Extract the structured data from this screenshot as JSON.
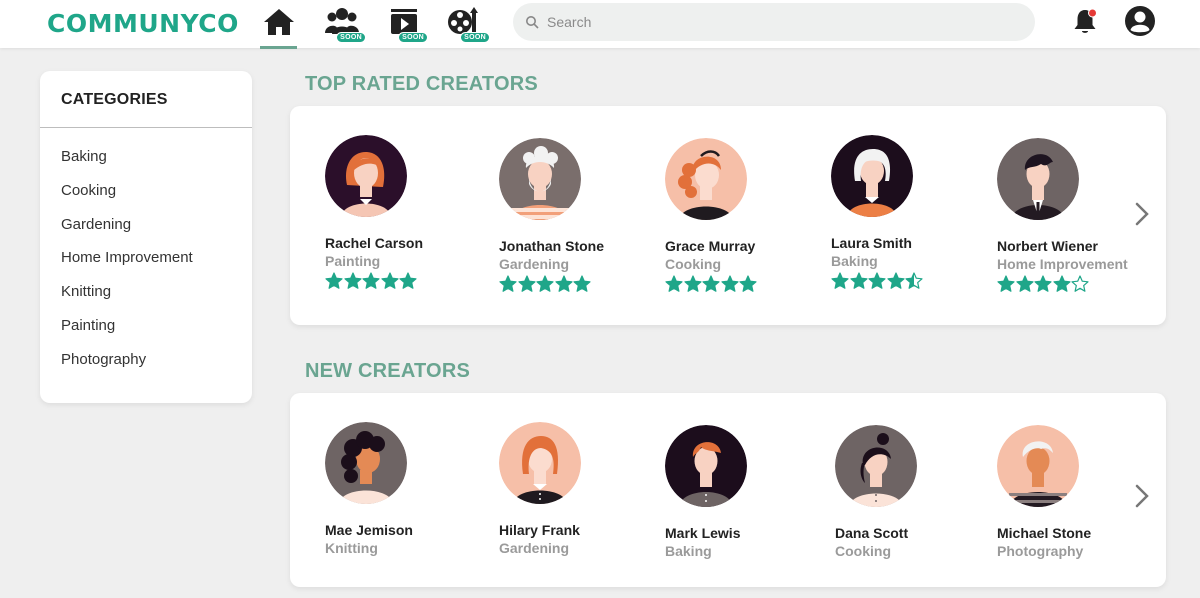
{
  "header": {
    "logo": "COMMUNYCO",
    "nav": [
      {
        "name": "home-icon",
        "active": true
      },
      {
        "name": "community-icon",
        "badge": "SOON"
      },
      {
        "name": "video-icon",
        "badge": "SOON"
      },
      {
        "name": "film-icon",
        "badge": "SOON"
      }
    ],
    "search_placeholder": "Search",
    "icons": [
      "search-icon",
      "bell-icon",
      "account-icon"
    ],
    "notification_dot_color": "#e53935"
  },
  "sidebar": {
    "title": "CATEGORIES",
    "items": [
      "Baking",
      "Cooking",
      "Gardening",
      "Home Improvement",
      "Knitting",
      "Painting",
      "Photography"
    ]
  },
  "top_rated": {
    "title": "TOP RATED CREATORS",
    "creators": [
      {
        "name": "Rachel Carson",
        "category": "Painting",
        "rating": 5
      },
      {
        "name": "Jonathan Stone",
        "category": "Gardening",
        "rating": 5
      },
      {
        "name": "Grace Murray",
        "category": "Cooking",
        "rating": 5
      },
      {
        "name": "Laura Smith",
        "category": "Baking",
        "rating": 4.5
      },
      {
        "name": "Norbert Wiener",
        "category": "Home Improvement",
        "rating": 4
      }
    ]
  },
  "new_creators": {
    "title": "NEW CREATORS",
    "creators": [
      {
        "name": "Mae Jemison",
        "category": "Knitting"
      },
      {
        "name": "Hilary Frank",
        "category": "Gardening"
      },
      {
        "name": "Mark Lewis",
        "category": "Baking"
      },
      {
        "name": "Dana Scott",
        "category": "Cooking"
      },
      {
        "name": "Michael Stone",
        "category": "Photography"
      }
    ]
  },
  "colors": {
    "brand": "#1fa689",
    "section_title": "#6aa591",
    "star": "#1fa689"
  }
}
